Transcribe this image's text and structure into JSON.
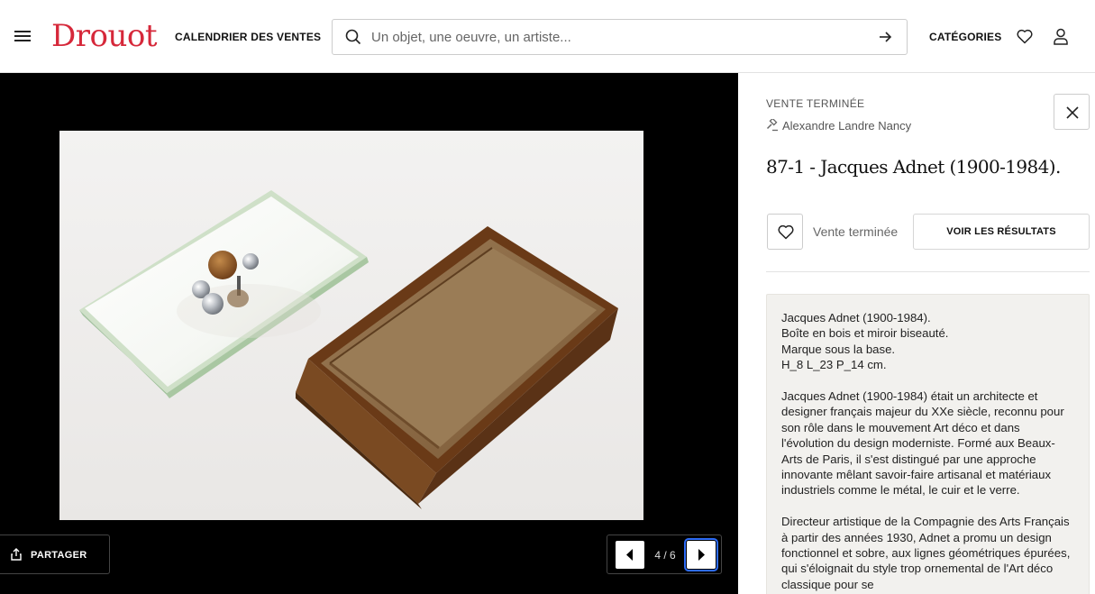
{
  "header": {
    "logo": "Drouot",
    "calendar_link": "CALENDRIER DES VENTES",
    "search_placeholder": "Un objet, une oeuvre, un artiste...",
    "categories_link": "CATÉGORIES",
    "icons": [
      "menu-icon",
      "search-icon",
      "arrow-right-icon",
      "heart-icon",
      "user-icon"
    ]
  },
  "viewer": {
    "share_label": "PARTAGER",
    "pager": {
      "current": 4,
      "total": 6,
      "label": "4 / 6"
    },
    "image_alt": "Boîte en bois et miroir biseauté"
  },
  "lot": {
    "status": "VENTE TERMINÉE",
    "auction_house": "Alexandre Landre Nancy",
    "title": "87-1 - Jacques Adnet (1900-1984).",
    "status_text": "Vente terminée",
    "results_button": "VOIR LES RÉSULTATS",
    "description": {
      "p1": {
        "line1": "Jacques Adnet (1900-1984).",
        "line2": "Boîte en bois et miroir biseauté.",
        "line3": "Marque sous la base.",
        "line4": "H_8 L_23 P_14 cm."
      },
      "p2": "Jacques Adnet (1900-1984) était un architecte et designer français majeur du XXe siècle, reconnu pour son rôle dans le mouvement Art déco et dans l'évolution du design moderniste. Formé aux Beaux-Arts de Paris, il s'est distingué par une approche innovante mêlant savoir-faire artisanal et matériaux industriels comme le métal, le cuir et le verre.",
      "p3": "Directeur artistique de la Compagnie des Arts Français à partir des années 1930, Adnet a promu un design fonctionnel et sobre, aux lignes géométriques épurées, qui s'éloignait du style trop ornemental de l'Art déco classique pour se"
    }
  },
  "colors": {
    "brand": "#d6283a",
    "viewer_bg": "#000000",
    "description_bg": "#f2f1ee"
  }
}
